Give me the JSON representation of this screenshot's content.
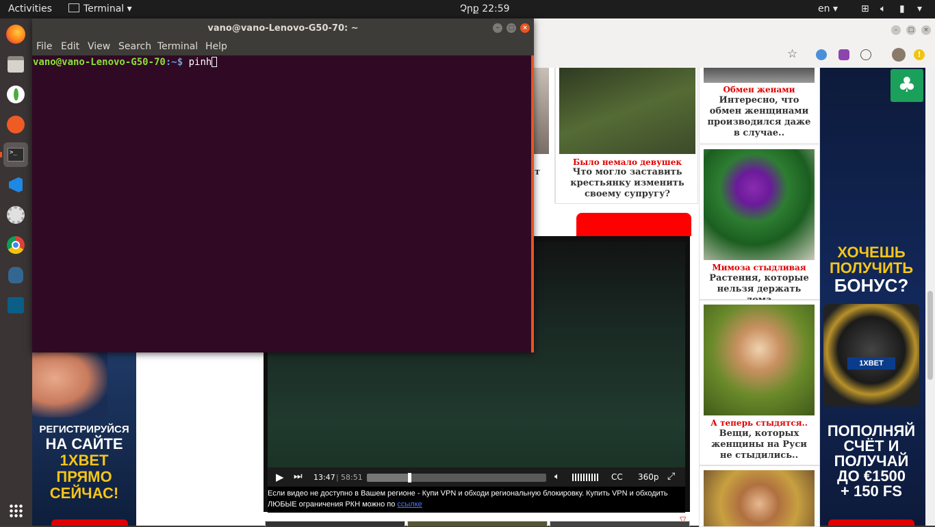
{
  "topbar": {
    "activities": "Activities",
    "app_name": "Terminal",
    "clock": "Չրք 22:59",
    "lang": "en"
  },
  "terminal": {
    "title": "vano@vano-Lenovo-G50-70: ~",
    "menu": [
      "File",
      "Edit",
      "View",
      "Search",
      "Terminal",
      "Help"
    ],
    "prompt_user": "vano@vano-Lenovo-G50-70",
    "prompt_path": ":~$ ",
    "command": "pinh"
  },
  "cards": [
    {
      "title": "Обмен женами",
      "text": "Интересно, что обмен женщинами производился даже в случае.."
    },
    {
      "title": "Было немало девушек",
      "text": "Что могло заставить крестьянку изменить своему супругу?"
    },
    {
      "title": "Мимоза стыдливая",
      "text": "Растения, которые нельзя держать дома"
    },
    {
      "title": "А теперь стыдятся..",
      "text": "Вещи, которых женщины на Руси не стыдились.."
    }
  ],
  "partial_text": "т",
  "video": {
    "time_current": "13:47",
    "time_sep": "|",
    "time_total": "58:51",
    "progress_fraction": 0.235,
    "cc": "CC",
    "quality": "360p",
    "note": "Если видео не доступно в Вашем регионе - Купи VPN и обходи региональную блокировку. Купить VPN и обходить ЛЮБЫЕ ограничения РКН можно по ",
    "note_link": "ссылке"
  },
  "ad_left": {
    "text": "РЕГИСТРИРУЙСЯ НА САЙТЕ 1XBET ПРЯМО СЕЙЧАС!",
    "lines": [
      "РЕГИСТРИРУЙСЯ",
      "НА САЙТЕ",
      "1XBET",
      "ПРЯМО",
      "СЕЙЧАС!"
    ]
  },
  "ad_right": {
    "top_lines": [
      "ХОЧЕШЬ",
      "ПОЛУЧИТЬ",
      "БОНУС?"
    ],
    "bottom_lines": [
      "ПОПОЛНЯЙ",
      "СЧЁТ И",
      "ПОЛУЧАЙ",
      "ДО €1500",
      "+ 150 FS"
    ],
    "brand": "1XBET"
  },
  "colors": {
    "accent": "#e95420",
    "terminal_bg": "#300a24",
    "prompt_green": "#8ae234",
    "prompt_blue": "#729fcf",
    "card_title_red": "#e00000"
  }
}
